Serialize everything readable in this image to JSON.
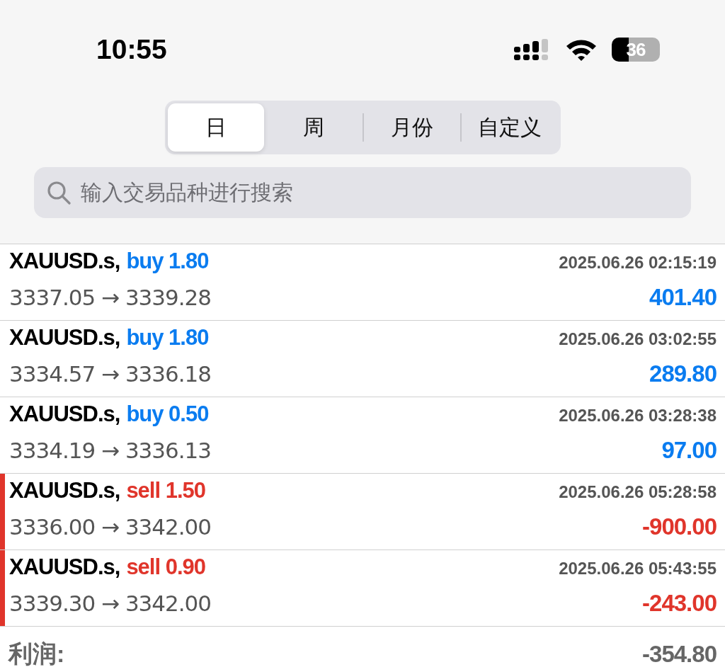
{
  "status_bar": {
    "time": "10:55",
    "battery": "36"
  },
  "period_tabs": [
    {
      "label": "日",
      "selected": true
    },
    {
      "label": "周",
      "selected": false
    },
    {
      "label": "月份",
      "selected": false
    },
    {
      "label": "自定义",
      "selected": false
    }
  ],
  "search": {
    "placeholder": "输入交易品种进行搜索"
  },
  "trades": [
    {
      "kind": "buy",
      "symbol": "XAUUSD.s,",
      "order": "buy 1.80",
      "time": "2025.06.26 02:15:19",
      "prices": "3337.05 → 3339.28",
      "profit": "401.40"
    },
    {
      "kind": "buy",
      "symbol": "XAUUSD.s,",
      "order": "buy 1.80",
      "time": "2025.06.26 03:02:55",
      "prices": "3334.57 → 3336.18",
      "profit": "289.80"
    },
    {
      "kind": "buy",
      "symbol": "XAUUSD.s,",
      "order": "buy 0.50",
      "time": "2025.06.26 03:28:38",
      "prices": "3334.19 → 3336.13",
      "profit": "97.00"
    },
    {
      "kind": "sell",
      "symbol": "XAUUSD.s,",
      "order": "sell 1.50",
      "time": "2025.06.26 05:28:58",
      "prices": "3336.00 → 3342.00",
      "profit": "-900.00"
    },
    {
      "kind": "sell",
      "symbol": "XAUUSD.s,",
      "order": "sell 0.90",
      "time": "2025.06.26 05:43:55",
      "prices": "3339.30 → 3342.00",
      "profit": "-243.00"
    }
  ],
  "summary": {
    "label": "利润:",
    "value": "-354.80"
  }
}
